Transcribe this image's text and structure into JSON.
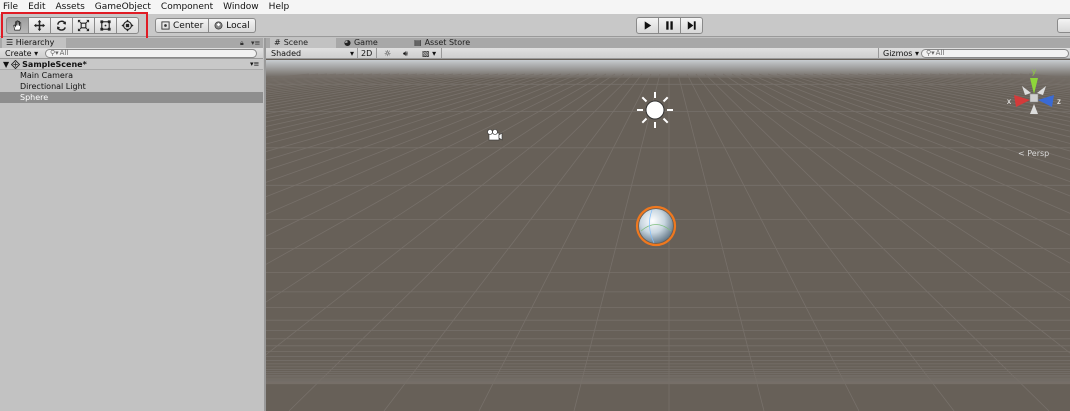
{
  "menu": [
    "File",
    "Edit",
    "Assets",
    "GameObject",
    "Component",
    "Window",
    "Help"
  ],
  "toolbar": {
    "tools": [
      "hand-icon",
      "move-icon",
      "rotate-icon",
      "scale-icon",
      "rect-icon",
      "transform-icon"
    ],
    "pivot_label": "Center",
    "space_label": "Local"
  },
  "hierarchy": {
    "tab": "Hierarchy",
    "create_label": "Create",
    "search_placeholder": "All",
    "scene_name": "SampleScene*",
    "items": [
      {
        "label": "Main Camera"
      },
      {
        "label": "Directional Light"
      },
      {
        "label": "Sphere",
        "selected": true
      }
    ]
  },
  "scene_tabs": [
    {
      "label": "Scene",
      "active": true
    },
    {
      "label": "Game"
    },
    {
      "label": "Asset Store"
    }
  ],
  "scene_toolbar": {
    "shading": "Shaded",
    "mode_2d": "2D",
    "gizmos": "Gizmos",
    "search_placeholder": "All"
  },
  "scene_view": {
    "projection": "Persp",
    "axes": {
      "x": "x",
      "y": "y",
      "z": "z"
    }
  },
  "colors": {
    "highlight": "#e01b24",
    "scene_bg": "#676058",
    "selection_outline": "#f0781e"
  }
}
